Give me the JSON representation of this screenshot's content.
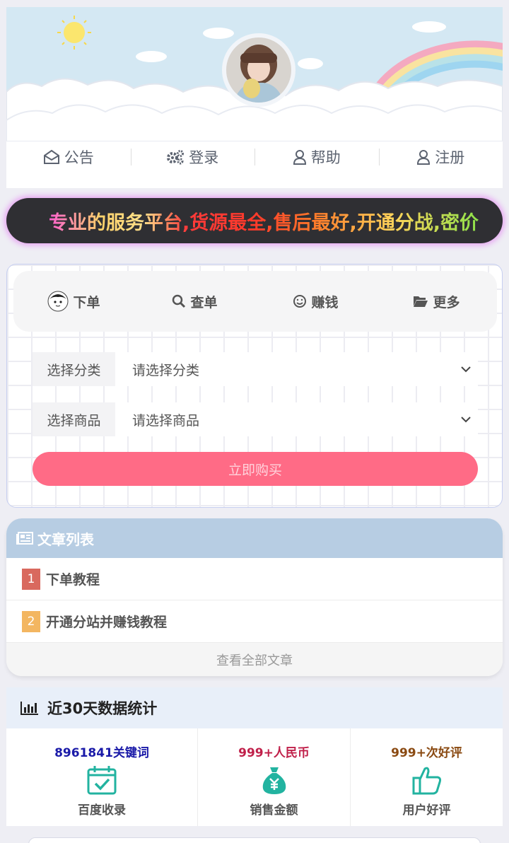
{
  "nav": {
    "items": [
      {
        "label": "公告",
        "icon": "envelope-open-icon"
      },
      {
        "label": "登录",
        "icon": "gears-icon"
      },
      {
        "label": "帮助",
        "icon": "user-icon"
      },
      {
        "label": "注册",
        "icon": "user-icon"
      }
    ]
  },
  "marquee": {
    "text": "专业的服务平台,货源最全,售后最好,开通分战,密价"
  },
  "order": {
    "tabs": [
      {
        "label": "下单",
        "icon": "cartoon-avatar-icon"
      },
      {
        "label": "查单",
        "icon": "search-icon"
      },
      {
        "label": "赚钱",
        "icon": "smile-icon"
      },
      {
        "label": "更多",
        "icon": "folder-open-icon"
      }
    ],
    "category": {
      "label": "选择分类",
      "value": "请选择分类"
    },
    "product": {
      "label": "选择商品",
      "value": "请选择商品"
    },
    "buy_label": "立即购买"
  },
  "articles": {
    "title": "文章列表",
    "items": [
      {
        "num": "1",
        "title": "下单教程",
        "color": "#d9695e"
      },
      {
        "num": "2",
        "title": "开通分站并赚钱教程",
        "color": "#f3b661"
      }
    ],
    "view_all": "查看全部文章"
  },
  "stats": {
    "title": "近30天数据统计",
    "items": [
      {
        "value": "8961841关键词",
        "label": "百度收录",
        "color": "#1a1aa8",
        "icon": "calendar-check-icon"
      },
      {
        "value": "999+人民币",
        "label": "销售金额",
        "color": "#c0204a",
        "icon": "money-bag-icon"
      },
      {
        "value": "999+次好评",
        "label": "用户好评",
        "color": "#8a4a12",
        "icon": "thumbs-up-icon"
      }
    ]
  },
  "colors": {
    "accent": "#ff6b86",
    "header_blue": "#b7cde3",
    "teal_icon": "#22b3a0"
  }
}
